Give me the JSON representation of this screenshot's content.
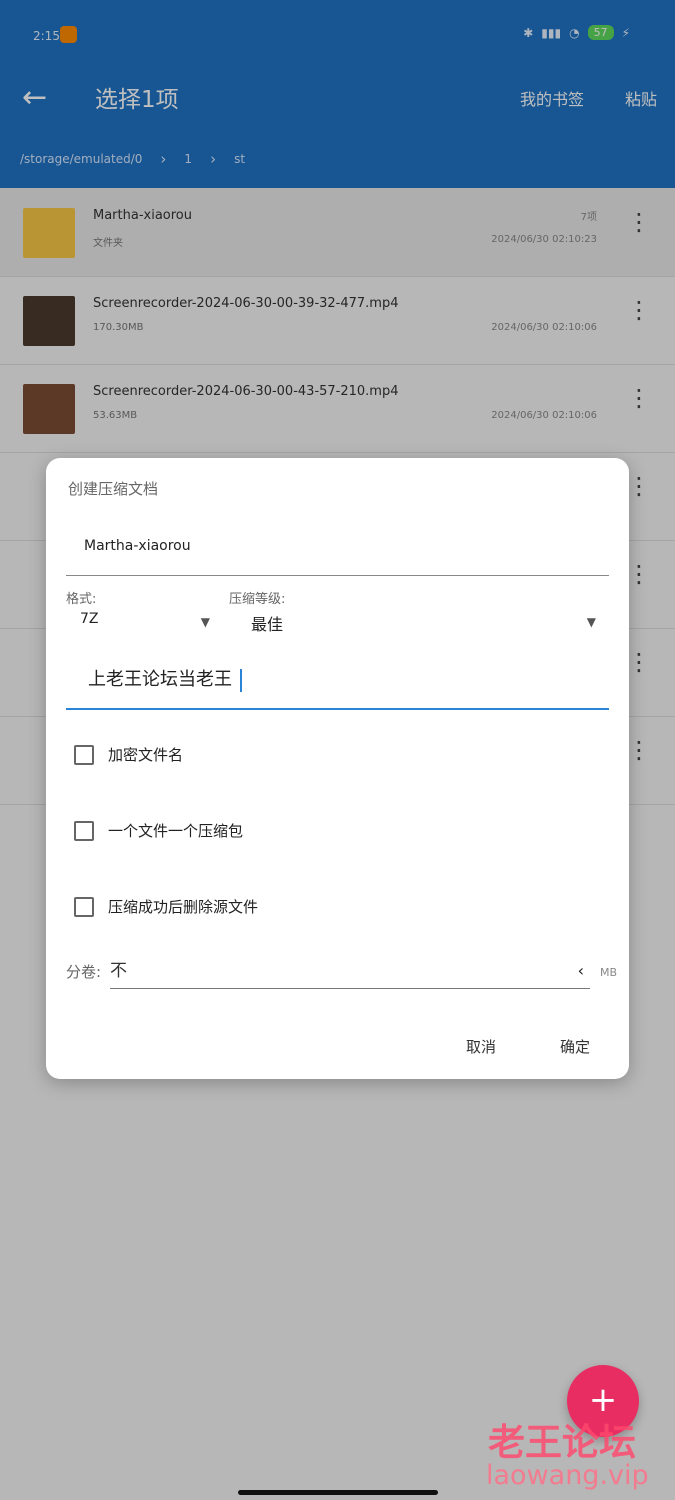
{
  "status": {
    "time": "2:15",
    "battery": "57"
  },
  "appbar": {
    "title": "选择1项",
    "bookmark": "我的书签",
    "paste": "粘贴",
    "path": [
      "/storage/emulated/0",
      "1",
      "st"
    ]
  },
  "list": [
    {
      "name": "Martha-xiaorou",
      "meta": "文件夹",
      "right1": "7项",
      "right2": "2024/06/30 02:10:23"
    },
    {
      "name": "Screenrecorder-2024-06-30-00-39-32-477.mp4",
      "meta": "170.30MB",
      "right1": "",
      "right2": "2024/06/30 02:10:06"
    },
    {
      "name": "Screenrecorder-2024-06-30-00-43-57-210.mp4",
      "meta": "53.63MB",
      "right1": "",
      "right2": "2024/06/30 02:10:06"
    }
  ],
  "dialog": {
    "title": "创建压缩文档",
    "name_value": "Martha-xiaorou",
    "format_label": "格式:",
    "format_value": "7Z",
    "level_label": "压缩等级:",
    "level_value": "最佳",
    "password_value": "上老王论坛当老王",
    "checkbox1": "加密文件名",
    "checkbox2": "一个文件一个压缩包",
    "checkbox3": "压缩成功后删除源文件",
    "split_label": "分卷:",
    "split_value": "不",
    "split_unit": "MB",
    "cancel": "取消",
    "ok": "确定"
  },
  "fab": {
    "label": "+"
  },
  "watermark": {
    "text": "老王论坛",
    "sub": "laowang.vip"
  }
}
